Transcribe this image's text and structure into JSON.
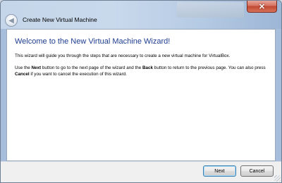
{
  "window": {
    "title": "Create New Virtual Machine",
    "close_glyph": "✕"
  },
  "wizard": {
    "heading": "Welcome to the New Virtual Machine Wizard!",
    "intro": "This wizard will guide you through the steps that are necessary to create a new virtual machine for VirtualBox.",
    "instructions": {
      "part1": "Use the ",
      "next_word": "Next",
      "part2": " button to go to the next page of the wizard and the ",
      "back_word": "Back",
      "part3": " button to return to the previous page. You can also press ",
      "cancel_word": "Cancel",
      "part4": " if you want to cancel the execution of this wizard."
    }
  },
  "buttons": {
    "next_label": "Next",
    "cancel_label": "Cancel"
  },
  "colors": {
    "heading": "#1e3d8f",
    "close": "#c2472f"
  }
}
